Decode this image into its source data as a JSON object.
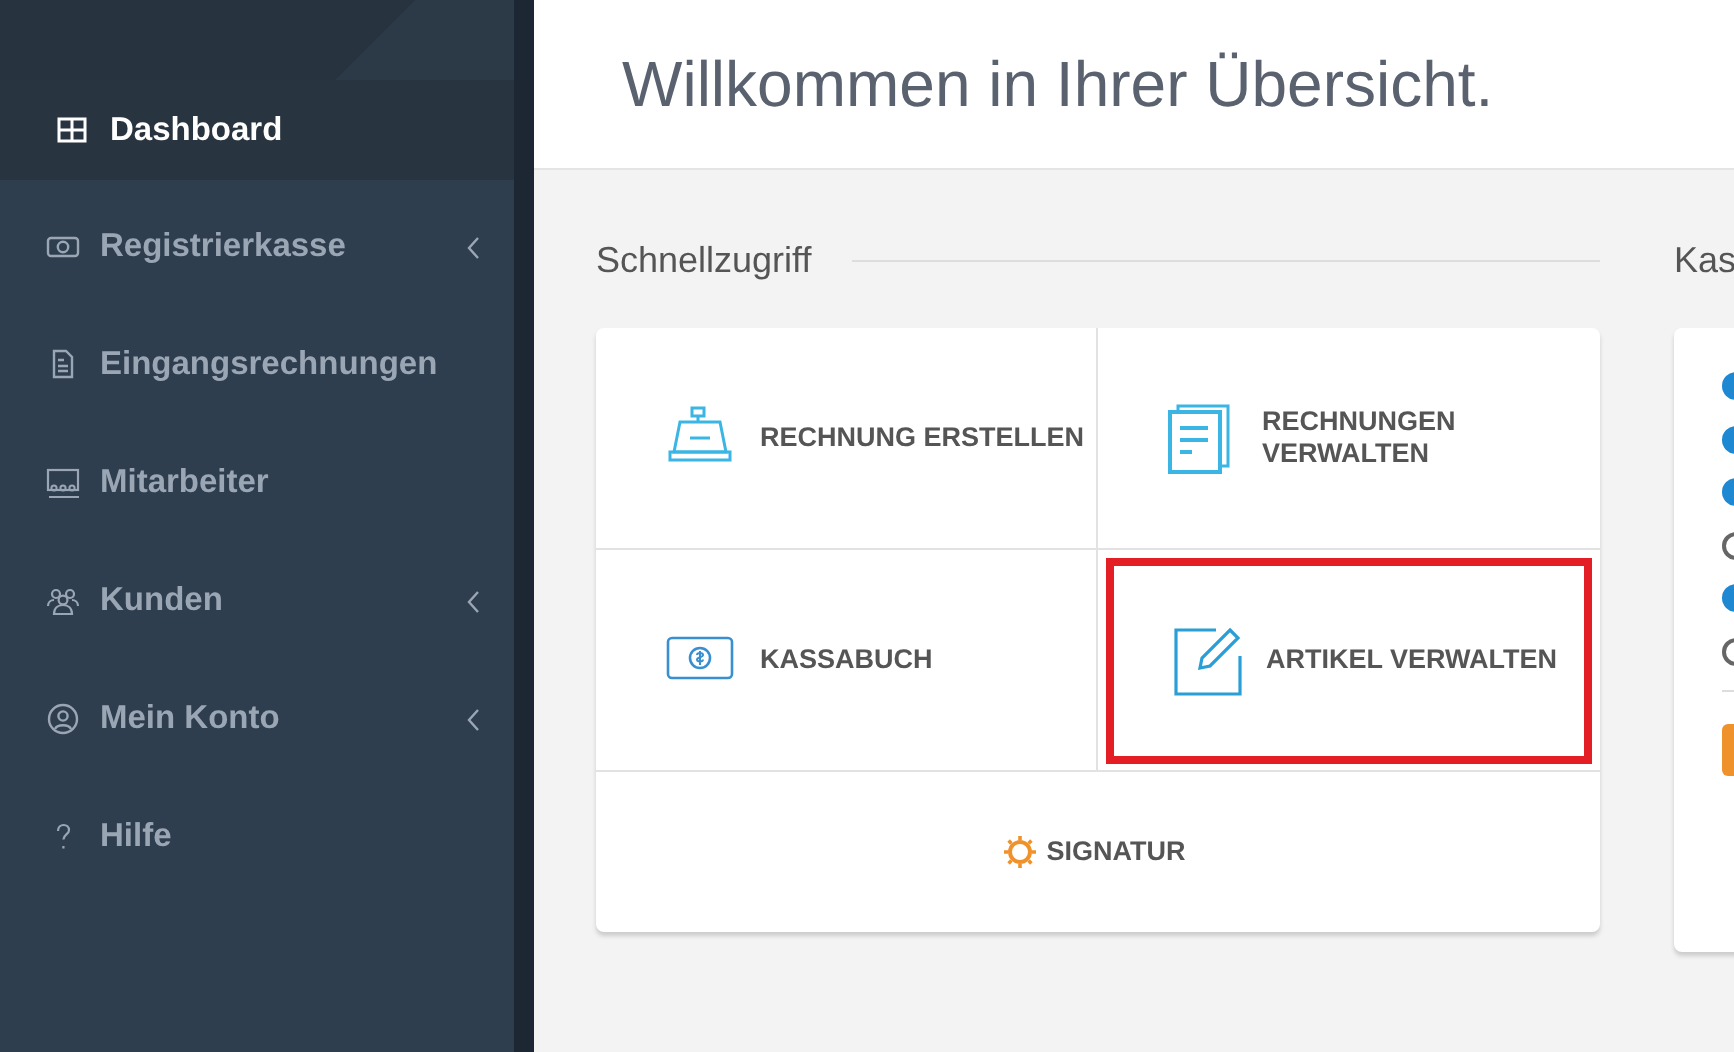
{
  "sidebar": {
    "items": [
      {
        "label": "Dashboard",
        "selected": true,
        "submenu": false
      },
      {
        "label": "Registrierkasse",
        "selected": false,
        "submenu": true
      },
      {
        "label": "Eingangsrechnungen",
        "selected": false,
        "submenu": false
      },
      {
        "label": "Mitarbeiter",
        "selected": false,
        "submenu": false
      },
      {
        "label": "Kunden",
        "selected": false,
        "submenu": true
      },
      {
        "label": "Mein Konto",
        "selected": false,
        "submenu": true
      },
      {
        "label": "Hilfe",
        "selected": false,
        "submenu": false
      }
    ]
  },
  "header": {
    "title": "Willkommen in Ihrer Übersicht."
  },
  "quick_access": {
    "title": "Schnellzugriff",
    "tiles": [
      {
        "label": "RECHNUNG ERSTELLEN",
        "kind": "tile",
        "highlighted": false
      },
      {
        "label": "RECHNUNGEN VERWALTEN",
        "kind": "tile",
        "highlighted": false
      },
      {
        "label": "KASSABUCH",
        "kind": "tile",
        "highlighted": false
      },
      {
        "label": "ARTIKEL VERWALTEN",
        "kind": "tile",
        "highlighted": true
      },
      {
        "label": "SIGNATUR",
        "kind": "wide",
        "highlighted": false
      }
    ]
  },
  "side_panel": {
    "title": "Kas",
    "options": [
      {
        "on": true
      },
      {
        "on": true
      },
      {
        "on": true
      },
      {
        "on": false
      },
      {
        "on": true
      },
      {
        "on": false
      }
    ]
  }
}
